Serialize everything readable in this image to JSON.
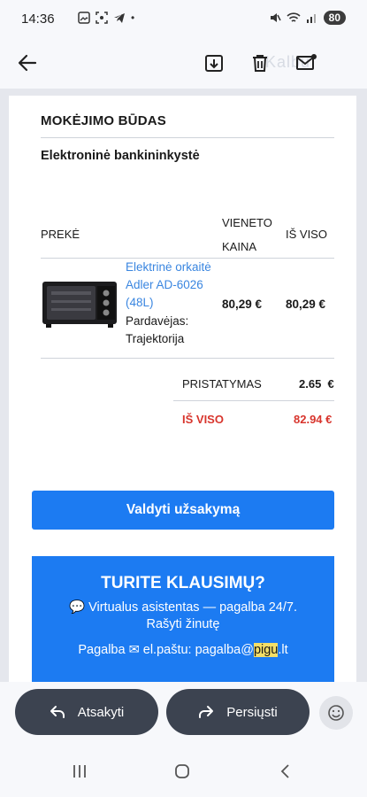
{
  "status": {
    "time": "14:36",
    "battery": "80"
  },
  "app_bar": {
    "watermark": "Kalbu"
  },
  "email": {
    "payment_title": "MOKĖJIMO BŪDAS",
    "payment_method": "Elektroninė bankininkystė",
    "table": {
      "col_item": "PREKĖ",
      "col_unit_price_line1": "VIENETO",
      "col_unit_price_line2": "KAINA",
      "col_total": "IŠ VISO"
    },
    "product": {
      "name": "Elektrinė orkaitė Adler AD-6026 (48L)",
      "seller_label": "Pardavėjas:",
      "seller_name": "Trajektorija",
      "unit_price": "80,29 €",
      "total": "80,29 €"
    },
    "delivery_label": "PRISTATYMAS",
    "delivery_value": "2.65  €",
    "total_label": "IŠ VISO",
    "total_value": "82.94 €",
    "manage_button": "Valdyti užsakymą",
    "help": {
      "title": "TURITE KLAUSIMŲ?",
      "line1": "💬 Virtualus asistentas — pagalba 24/7.",
      "line2": "Rašyti žinutę",
      "line3_prefix": "Pagalba ✉ el.paštu: pagalba@",
      "line3_highlight": "pigu",
      "line3_suffix": ".lt"
    }
  },
  "actions": {
    "reply": "Atsakyti",
    "forward": "Persiųsti"
  }
}
